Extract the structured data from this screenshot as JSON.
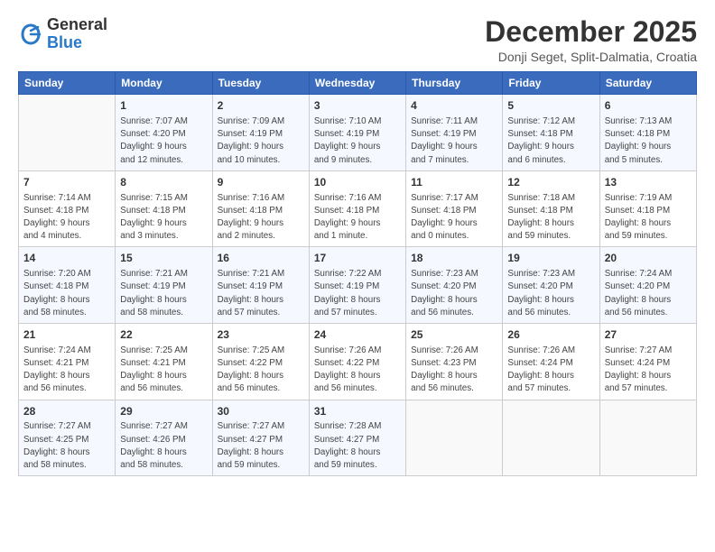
{
  "logo": {
    "general": "General",
    "blue": "Blue"
  },
  "title": {
    "month_year": "December 2025",
    "location": "Donji Seget, Split-Dalmatia, Croatia"
  },
  "days_of_week": [
    "Sunday",
    "Monday",
    "Tuesday",
    "Wednesday",
    "Thursday",
    "Friday",
    "Saturday"
  ],
  "weeks": [
    [
      {
        "day": null,
        "info": null
      },
      {
        "day": "1",
        "info": "Sunrise: 7:07 AM\nSunset: 4:20 PM\nDaylight: 9 hours\nand 12 minutes."
      },
      {
        "day": "2",
        "info": "Sunrise: 7:09 AM\nSunset: 4:19 PM\nDaylight: 9 hours\nand 10 minutes."
      },
      {
        "day": "3",
        "info": "Sunrise: 7:10 AM\nSunset: 4:19 PM\nDaylight: 9 hours\nand 9 minutes."
      },
      {
        "day": "4",
        "info": "Sunrise: 7:11 AM\nSunset: 4:19 PM\nDaylight: 9 hours\nand 7 minutes."
      },
      {
        "day": "5",
        "info": "Sunrise: 7:12 AM\nSunset: 4:18 PM\nDaylight: 9 hours\nand 6 minutes."
      },
      {
        "day": "6",
        "info": "Sunrise: 7:13 AM\nSunset: 4:18 PM\nDaylight: 9 hours\nand 5 minutes."
      }
    ],
    [
      {
        "day": "7",
        "info": "Sunrise: 7:14 AM\nSunset: 4:18 PM\nDaylight: 9 hours\nand 4 minutes."
      },
      {
        "day": "8",
        "info": "Sunrise: 7:15 AM\nSunset: 4:18 PM\nDaylight: 9 hours\nand 3 minutes."
      },
      {
        "day": "9",
        "info": "Sunrise: 7:16 AM\nSunset: 4:18 PM\nDaylight: 9 hours\nand 2 minutes."
      },
      {
        "day": "10",
        "info": "Sunrise: 7:16 AM\nSunset: 4:18 PM\nDaylight: 9 hours\nand 1 minute."
      },
      {
        "day": "11",
        "info": "Sunrise: 7:17 AM\nSunset: 4:18 PM\nDaylight: 9 hours\nand 0 minutes."
      },
      {
        "day": "12",
        "info": "Sunrise: 7:18 AM\nSunset: 4:18 PM\nDaylight: 8 hours\nand 59 minutes."
      },
      {
        "day": "13",
        "info": "Sunrise: 7:19 AM\nSunset: 4:18 PM\nDaylight: 8 hours\nand 59 minutes."
      }
    ],
    [
      {
        "day": "14",
        "info": "Sunrise: 7:20 AM\nSunset: 4:18 PM\nDaylight: 8 hours\nand 58 minutes."
      },
      {
        "day": "15",
        "info": "Sunrise: 7:21 AM\nSunset: 4:19 PM\nDaylight: 8 hours\nand 58 minutes."
      },
      {
        "day": "16",
        "info": "Sunrise: 7:21 AM\nSunset: 4:19 PM\nDaylight: 8 hours\nand 57 minutes."
      },
      {
        "day": "17",
        "info": "Sunrise: 7:22 AM\nSunset: 4:19 PM\nDaylight: 8 hours\nand 57 minutes."
      },
      {
        "day": "18",
        "info": "Sunrise: 7:23 AM\nSunset: 4:20 PM\nDaylight: 8 hours\nand 56 minutes."
      },
      {
        "day": "19",
        "info": "Sunrise: 7:23 AM\nSunset: 4:20 PM\nDaylight: 8 hours\nand 56 minutes."
      },
      {
        "day": "20",
        "info": "Sunrise: 7:24 AM\nSunset: 4:20 PM\nDaylight: 8 hours\nand 56 minutes."
      }
    ],
    [
      {
        "day": "21",
        "info": "Sunrise: 7:24 AM\nSunset: 4:21 PM\nDaylight: 8 hours\nand 56 minutes."
      },
      {
        "day": "22",
        "info": "Sunrise: 7:25 AM\nSunset: 4:21 PM\nDaylight: 8 hours\nand 56 minutes."
      },
      {
        "day": "23",
        "info": "Sunrise: 7:25 AM\nSunset: 4:22 PM\nDaylight: 8 hours\nand 56 minutes."
      },
      {
        "day": "24",
        "info": "Sunrise: 7:26 AM\nSunset: 4:22 PM\nDaylight: 8 hours\nand 56 minutes."
      },
      {
        "day": "25",
        "info": "Sunrise: 7:26 AM\nSunset: 4:23 PM\nDaylight: 8 hours\nand 56 minutes."
      },
      {
        "day": "26",
        "info": "Sunrise: 7:26 AM\nSunset: 4:24 PM\nDaylight: 8 hours\nand 57 minutes."
      },
      {
        "day": "27",
        "info": "Sunrise: 7:27 AM\nSunset: 4:24 PM\nDaylight: 8 hours\nand 57 minutes."
      }
    ],
    [
      {
        "day": "28",
        "info": "Sunrise: 7:27 AM\nSunset: 4:25 PM\nDaylight: 8 hours\nand 58 minutes."
      },
      {
        "day": "29",
        "info": "Sunrise: 7:27 AM\nSunset: 4:26 PM\nDaylight: 8 hours\nand 58 minutes."
      },
      {
        "day": "30",
        "info": "Sunrise: 7:27 AM\nSunset: 4:27 PM\nDaylight: 8 hours\nand 59 minutes."
      },
      {
        "day": "31",
        "info": "Sunrise: 7:28 AM\nSunset: 4:27 PM\nDaylight: 8 hours\nand 59 minutes."
      },
      {
        "day": null,
        "info": null
      },
      {
        "day": null,
        "info": null
      },
      {
        "day": null,
        "info": null
      }
    ]
  ]
}
